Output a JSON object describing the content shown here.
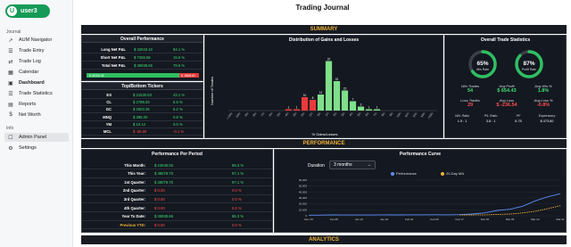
{
  "sidebar": {
    "user": {
      "initial": "U",
      "name": "user3"
    },
    "section_journal": "Journal",
    "items": [
      {
        "label": "AUM Navigator",
        "icon": "trending-icon"
      },
      {
        "label": "Trade Entry",
        "icon": "list-icon"
      },
      {
        "label": "Trade Log",
        "icon": "swap-icon"
      },
      {
        "label": "Calendar",
        "icon": "calendar-icon"
      },
      {
        "label": "Dashboard",
        "icon": "dashboard-icon"
      },
      {
        "label": "Trade Statistics",
        "icon": "list-icon"
      },
      {
        "label": "Reports",
        "icon": "report-icon"
      },
      {
        "label": "Net Worth",
        "icon": "money-icon"
      }
    ],
    "section_info": "Info",
    "info_items": [
      {
        "label": "Admin Panel",
        "icon": "admin-icon"
      },
      {
        "label": "Settings",
        "icon": "gear-icon"
      }
    ]
  },
  "page_title": "Trading Journal",
  "sections": {
    "summary": "SUMMARY",
    "performance": "PERFORMANCE",
    "analytics": "ANALYTICS"
  },
  "overall_performance": {
    "title": "Overall Performance",
    "rows": [
      {
        "label": "Long Net P&L",
        "value": "$ 32043.10",
        "pct": "84.1 %"
      },
      {
        "label": "Short Net P&L",
        "value": "$ 7255.56",
        "pct": "15.5 %"
      },
      {
        "label": "Total Net P&L",
        "value": "$ 36938.66",
        "pct": "78.6 %"
      }
    ],
    "win_bar_text": "$ 46706.28",
    "loss_bar_text": "$ -9808.62"
  },
  "top_bottom": {
    "title": "Top/Bottom Tickers",
    "top": [
      {
        "ticker": "ES",
        "value": "$ 21530.63",
        "pct": "43.1 %"
      },
      {
        "ticker": "CL",
        "value": "$ 2786.03",
        "pct": "5.6 %"
      },
      {
        "ticker": "GC",
        "value": "$ 2603.35",
        "pct": "5.2 %"
      }
    ],
    "bottom": [
      {
        "ticker": "MNQ",
        "value": "$ 395.00",
        "pct": "0.8 %"
      },
      {
        "ticker": "YM",
        "value": "$ 10.12",
        "pct": "0.0 %"
      },
      {
        "ticker": "MCL",
        "value": "$ -36.00",
        "pct": "-0.1 %"
      }
    ]
  },
  "distribution": {
    "title": "Distribution of Gains and Losses",
    "ylabel": "Number of Trades",
    "xlabel": "% Gains/Losses"
  },
  "chart_data": [
    {
      "type": "bar",
      "title": "Distribution of Gains and Losses",
      "xlabel": "% Gains/Losses",
      "ylabel": "Number of Trades",
      "categories": [
        "<-10%",
        "-10%",
        "-9%",
        "-8%",
        "-7%",
        "-6%",
        "-5%",
        "-4%",
        "-3%",
        "-2%",
        "-1%",
        "0%",
        "1%",
        "2%",
        "3%",
        "4%",
        "5%",
        "6%",
        "7%",
        "8%",
        "9%",
        "10%",
        "11%",
        "12%",
        "13%",
        ">13%"
      ],
      "values": [
        0,
        0,
        0,
        0,
        0,
        0,
        0,
        1,
        1,
        10,
        8,
        12,
        37,
        22,
        15,
        7,
        3,
        1,
        1,
        0,
        0,
        0,
        0,
        0,
        0,
        0
      ],
      "bar_colors": [
        "#e83a3a",
        "#e83a3a",
        "#e83a3a",
        "#e83a3a",
        "#e83a3a",
        "#e83a3a",
        "#e83a3a",
        "#e83a3a",
        "#e83a3a",
        "#e83a3a",
        "#e83a3a",
        "#7ee08a",
        "#7ee08a",
        "#7ee08a",
        "#7ee08a",
        "#7ee08a",
        "#7ee08a",
        "#7ee08a",
        "#7ee08a",
        "#7ee08a",
        "#7ee08a",
        "#7ee08a",
        "#7ee08a",
        "#7ee08a",
        "#7ee08a",
        "#7ee08a"
      ],
      "ylim": [
        0,
        40
      ]
    },
    {
      "type": "line",
      "title": "Performance Curve",
      "x": [
        "Dec 20",
        "Jan 04",
        "Jan 08",
        "Jan 12",
        "Jan 16",
        "Jan 20",
        "Jan 24",
        "Jan 28",
        "Feb 01",
        "Feb 05",
        "Feb 09",
        "Feb 13",
        "Feb 17",
        "Feb 21",
        "Feb 25",
        "Mar 01",
        "Mar 05",
        "Mar 09",
        "Mar 13",
        "Mar 17",
        "Mar 21"
      ],
      "series": [
        {
          "name": "Performance",
          "color": "#5b8ff9",
          "values": [
            1000,
            1200,
            1500,
            1300,
            1400,
            1300,
            1600,
            1500,
            1700,
            1600,
            1800,
            1700,
            2000,
            3000,
            5000,
            9000,
            11000,
            16000,
            25000,
            32000,
            37000
          ]
        },
        {
          "name": "20-Day MA",
          "color": "#f2b23a",
          "values": [
            null,
            null,
            null,
            null,
            null,
            null,
            null,
            null,
            null,
            null,
            null,
            null,
            1400,
            1500,
            1700,
            2200,
            3000,
            4800,
            7500,
            12000,
            17000
          ]
        }
      ],
      "ylim": [
        0,
        60000
      ],
      "yticks": [
        "0",
        "10,000",
        "20,000",
        "30,000",
        "40,000",
        "50,000",
        "60,000"
      ]
    }
  ],
  "overall_stats": {
    "title": "Overall Trade Statistics",
    "win_rate_pct": "65%",
    "win_rate_value": 0.65,
    "win_rate_label": "Win Rate",
    "profit_rate_pct": "87%",
    "profit_rate_value": 0.87,
    "profit_rate_label": "Profit Rate",
    "stats": [
      {
        "label": "Win Trades",
        "value": "54",
        "color": "#3cdc74"
      },
      {
        "label": "Avg Profit",
        "value": "$ 654.43",
        "color": "#3cdc74"
      },
      {
        "label": "Avg Win %",
        "value": "1.8%",
        "color": "#3cdc74"
      },
      {
        "label": "Loss Trades",
        "value": "29",
        "color": "#ff4d4d"
      },
      {
        "label": "Avg Loss",
        "value": "$ -236.54",
        "color": "#ff4d4d"
      },
      {
        "label": "Avg Loss %",
        "value": "-0.8%",
        "color": "#ff4d4d"
      }
    ],
    "small_stats": [
      {
        "label": "W/L Ratio",
        "value": "1.9 : 1"
      },
      {
        "label": "P/L Ratio",
        "value": "3.8 : 1"
      },
      {
        "label": "PF",
        "value": "6.75"
      },
      {
        "label": "Expectancy",
        "value": "$ 473.60"
      }
    ]
  },
  "performance_period": {
    "title": "Performance Per Period",
    "rows": [
      {
        "label": "This Month:",
        "value": "$ 23049.00",
        "pct": "86.3 %",
        "neutral": false
      },
      {
        "label": "This Year:",
        "value": "$ 38079.70",
        "pct": "97.1 %",
        "neutral": false
      },
      {
        "label": "1st Quarter:",
        "value": "$ 38079.70",
        "pct": "97.1 %",
        "neutral": false
      },
      {
        "label": "2nd Quarter:",
        "value": "$ 0.00",
        "pct": "0.0 %",
        "neutral": true
      },
      {
        "label": "3rd Quarter:",
        "value": "$ 0.00",
        "pct": "0.0 %",
        "neutral": true
      },
      {
        "label": "4th Quarter:",
        "value": "$ 0.00",
        "pct": "0.0 %",
        "neutral": true
      },
      {
        "label": "Year To Date:",
        "value": "$ 36938.66",
        "pct": "86.3 %",
        "neutral": false
      },
      {
        "label": "Previous YTD:",
        "value": "$ 0.00",
        "pct": "0.0 %",
        "neutral": true
      }
    ]
  },
  "performance_curve": {
    "title": "Performance Curve",
    "duration_label": "Duration",
    "duration_value": "3 months",
    "legend": [
      {
        "name": "Performance",
        "color": "#5b8ff9"
      },
      {
        "name": "20-Day MA",
        "color": "#f2b23a"
      }
    ]
  }
}
